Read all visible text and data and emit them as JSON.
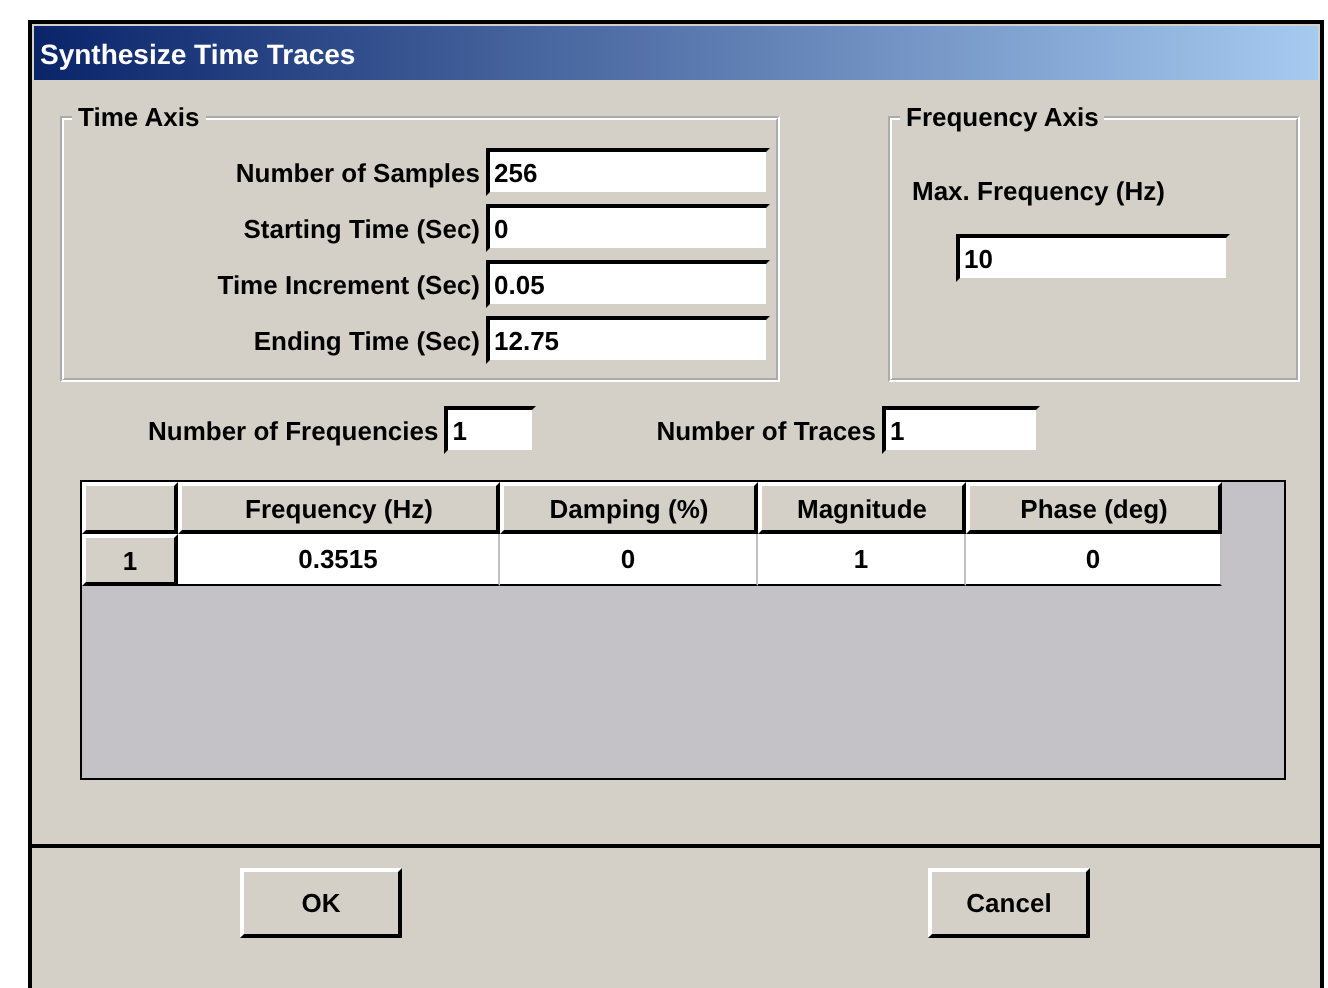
{
  "window": {
    "title": "Synthesize Time Traces"
  },
  "time_axis": {
    "title": "Time Axis",
    "fields": [
      {
        "label": "Number of Samples",
        "value": "256"
      },
      {
        "label": "Starting Time (Sec)",
        "value": "0"
      },
      {
        "label": "Time Increment (Sec)",
        "value": "0.05"
      },
      {
        "label": "Ending Time (Sec)",
        "value": "12.75"
      }
    ]
  },
  "frequency_axis": {
    "title": "Frequency Axis",
    "fields": [
      {
        "label": "Max. Frequency (Hz)",
        "value": "10"
      }
    ]
  },
  "counts": [
    {
      "label": "Number of Frequencies",
      "value": "1"
    },
    {
      "label": "Number of Traces",
      "value": "1"
    }
  ],
  "table": {
    "columns": [
      "Frequency (Hz)",
      "Damping (%)",
      "Magnitude",
      "Phase (deg)"
    ],
    "rows": [
      {
        "header": "1",
        "cells": [
          "0.3515",
          "0",
          "1",
          "0"
        ]
      }
    ]
  },
  "buttons": [
    "OK",
    "Cancel"
  ]
}
